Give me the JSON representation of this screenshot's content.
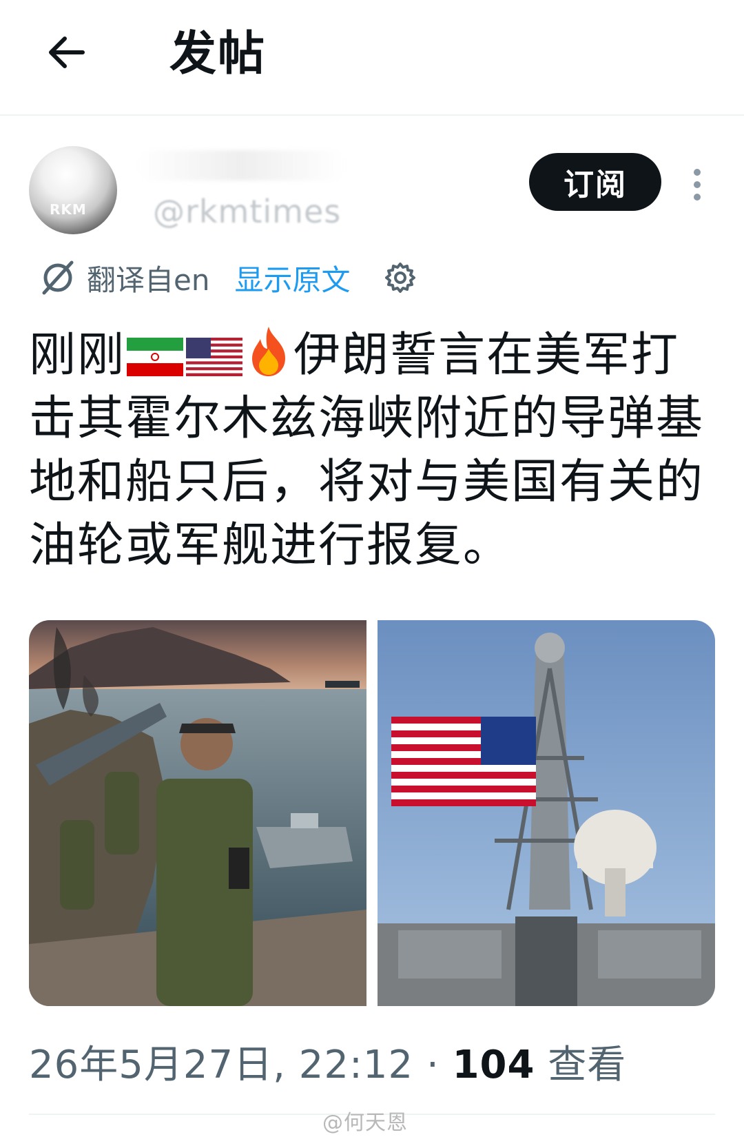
{
  "header": {
    "title": "发帖"
  },
  "post": {
    "avatar_text": "RKM",
    "handle": "@rkmtimes",
    "subscribe_label": "订阅",
    "translation": {
      "label": "翻译自en",
      "show_original": "显示原文"
    },
    "text": {
      "prefix": "刚刚",
      "body": "伊朗誓言在美军打击其霍尔木兹海峡附近的导弹基地和船只后，将对与美国有关的油轮或军舰进行报复。"
    },
    "flags": [
      "iran-flag-icon",
      "usa-flag-icon"
    ],
    "emoji": "fire-icon",
    "meta": {
      "timestamp": "26年5月27日, 22:12",
      "separator": "·",
      "views_count": "104",
      "views_label": "查看"
    }
  },
  "watermark": "@何天恩",
  "colors": {
    "text": "#0f1419",
    "secondary": "#536471",
    "link": "#1d9bf0",
    "button_bg": "#0f1419",
    "divider": "#eff3f4"
  }
}
